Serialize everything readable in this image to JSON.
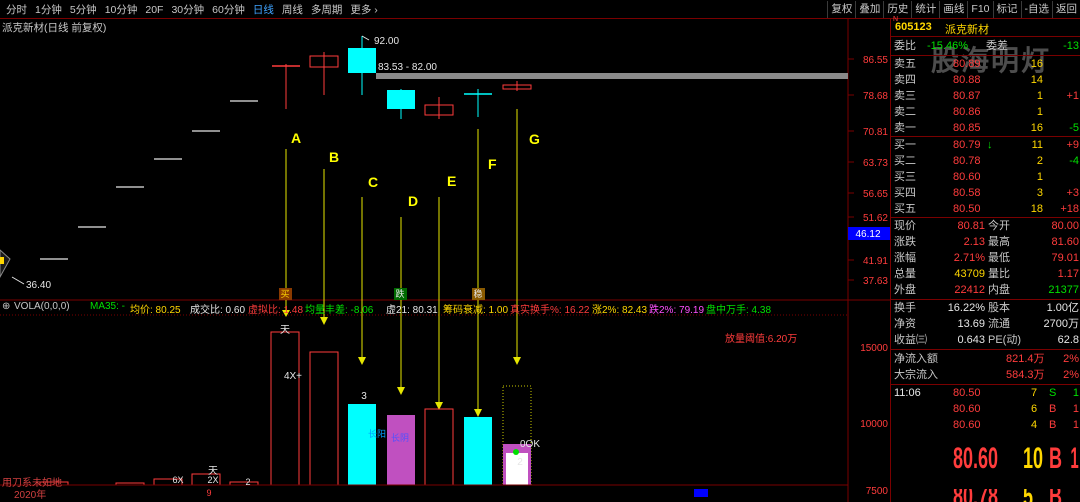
{
  "toolbar": {
    "period_tabs": [
      "分时",
      "1分钟",
      "5分钟",
      "10分钟",
      "20F",
      "30分钟",
      "60分钟",
      "日线",
      "周线",
      "多周期",
      "更多 ›"
    ],
    "active_tab": "日线",
    "right_tools": [
      "复权",
      "叠加",
      "历史",
      "统计",
      "画线",
      "F10",
      "标记",
      "-自选",
      "返回"
    ]
  },
  "chart": {
    "stock_title": "派克新材(日线 前复权)",
    "price_axis": [
      "86.55",
      "78.68",
      "70.81",
      "63.73",
      "56.65",
      "51.62",
      "46.12",
      "41.91",
      "37.63"
    ],
    "price_axis_highlight": "46.12",
    "vol_axis": [
      "15000",
      "10000",
      "7500"
    ],
    "annotations": {
      "high_label": "92.00",
      "range_label": "83.53 - 82.00",
      "low_label": "36.40",
      "letters": [
        "A",
        "B",
        "C",
        "D",
        "E",
        "F",
        "G"
      ],
      "signal_dots": [
        "买",
        "跌",
        "稳"
      ],
      "threshold_label": "放量阈值:6.20万",
      "bar_labels": {
        "tian": "天",
        "four_x": "4X+",
        "three": "3",
        "chang_yang": "长阳",
        "chang_yin": "长阴",
        "zero_ok": "0OK",
        "two": "2",
        "small_tian": "天",
        "six_x": "6X",
        "two_x": "2X",
        "nine": "9"
      },
      "bottom_labels": [
        "用刀系未如地",
        "2020年"
      ]
    }
  },
  "indicator": {
    "name": "VOLA(0,0,0)",
    "ma35": "MA35: -",
    "avg_price": "均价: 80.25",
    "deal_ratio": "成交比: 0.60",
    "virtual_ratio": "虚拟比: 1.48",
    "vol_diff": "均量丰差: -8.06",
    "vir21": "虚21: 80.31",
    "chip": "筹码衰减: 1.00",
    "real_turnover": "真实换手%: 16.22",
    "up2": "涨2%: 82.43",
    "down2": "跌2%: 79.19",
    "pan": "盘中万手: 4.38"
  },
  "quote": {
    "code": "605123",
    "name": "派克新材",
    "sup": "N",
    "watermark": "股海明灯",
    "weibi": {
      "label": "委比",
      "value": "-15.46%",
      "label2": "委差",
      "value2": "-13"
    },
    "asks": [
      {
        "label": "卖五",
        "price": "80.89",
        "vol": "16",
        "chg": ""
      },
      {
        "label": "卖四",
        "price": "80.88",
        "vol": "14",
        "chg": ""
      },
      {
        "label": "卖三",
        "price": "80.87",
        "vol": "1",
        "chg": "+1"
      },
      {
        "label": "卖二",
        "price": "80.86",
        "vol": "1",
        "chg": ""
      },
      {
        "label": "卖一",
        "price": "80.85",
        "vol": "16",
        "chg": "-5"
      }
    ],
    "bids": [
      {
        "label": "买一",
        "price": "80.79",
        "vol": "11",
        "chg": "+9"
      },
      {
        "label": "买二",
        "price": "80.78",
        "vol": "2",
        "chg": "-4"
      },
      {
        "label": "买三",
        "price": "80.60",
        "vol": "1",
        "chg": ""
      },
      {
        "label": "买四",
        "price": "80.58",
        "vol": "3",
        "chg": "+3"
      },
      {
        "label": "买五",
        "price": "80.50",
        "vol": "18",
        "chg": "+18"
      }
    ],
    "stats": [
      {
        "l1": "现价",
        "v1": "80.81",
        "c1": "red",
        "l2": "今开",
        "v2": "80.00",
        "c2": "red"
      },
      {
        "l1": "涨跌",
        "v1": "2.13",
        "c1": "red",
        "l2": "最高",
        "v2": "81.60",
        "c2": "red"
      },
      {
        "l1": "涨幅",
        "v1": "2.71%",
        "c1": "red",
        "l2": "最低",
        "v2": "79.01",
        "c2": "red"
      },
      {
        "l1": "总量",
        "v1": "43709",
        "c1": "yellow",
        "l2": "量比",
        "v2": "1.17",
        "c2": "red"
      },
      {
        "l1": "外盘",
        "v1": "22412",
        "c1": "red",
        "l2": "内盘",
        "v2": "21377",
        "c2": "green"
      },
      {
        "l1": "换手",
        "v1": "16.22%",
        "c1": "white",
        "l2": "股本",
        "v2": "1.00亿",
        "c2": "white"
      },
      {
        "l1": "净资",
        "v1": "13.69",
        "c1": "white",
        "l2": "流通",
        "v2": "2700万",
        "c2": "white"
      },
      {
        "l1": "收益㈢",
        "v1": "0.643",
        "c1": "white",
        "l2": "PE(动)",
        "v2": "62.8",
        "c2": "white"
      }
    ],
    "flows": [
      {
        "label": "净流入额",
        "value": "821.4万",
        "pct": "2%"
      },
      {
        "label": "大宗流入",
        "value": "584.3万",
        "pct": "2%"
      }
    ],
    "ticks": [
      {
        "time": "11:06",
        "price": "80.50",
        "vol": "7",
        "bs": "S"
      },
      {
        "time": "",
        "price": "80.60",
        "vol": "6",
        "bs": "B"
      },
      {
        "time": "",
        "price": "80.60",
        "vol": "4",
        "bs": "B"
      }
    ],
    "big_ticks": [
      {
        "price": "80.60",
        "vol": "10",
        "bs": "B"
      },
      {
        "price": "80.78",
        "vol": "5",
        "bs": "B"
      }
    ]
  }
}
